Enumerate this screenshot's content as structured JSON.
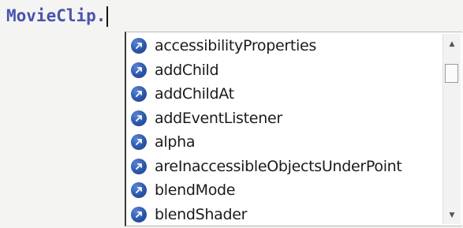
{
  "editor": {
    "code_text": "MovieClip."
  },
  "autocomplete": {
    "items": [
      {
        "label": "accessibilityProperties",
        "icon": "property-icon"
      },
      {
        "label": "addChild",
        "icon": "method-icon"
      },
      {
        "label": "addChildAt",
        "icon": "method-icon"
      },
      {
        "label": "addEventListener",
        "icon": "method-icon"
      },
      {
        "label": "alpha",
        "icon": "property-icon"
      },
      {
        "label": "areInaccessibleObjectsUnderPoint",
        "icon": "method-icon"
      },
      {
        "label": "blendMode",
        "icon": "property-icon"
      },
      {
        "label": "blendShader",
        "icon": "property-icon"
      }
    ],
    "scroll_up_glyph": "▲",
    "scroll_down_glyph": "▼"
  },
  "colors": {
    "code_text": "#4a52b0",
    "icon_blue": "#2b56ab"
  }
}
